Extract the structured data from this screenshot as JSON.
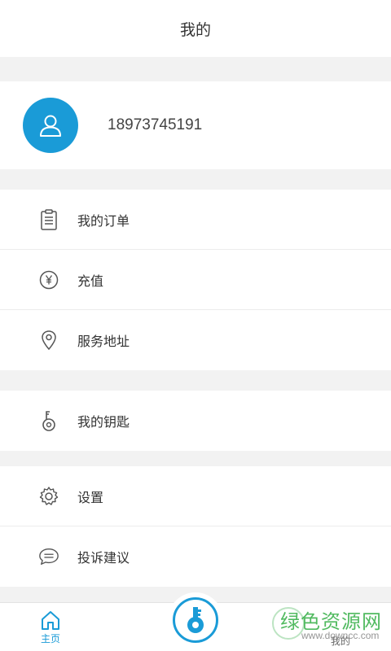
{
  "header": {
    "title": "我的"
  },
  "profile": {
    "phone": "18973745191",
    "avatar_icon": "user-icon"
  },
  "menu": {
    "group1": [
      {
        "label": "我的订单",
        "icon": "clipboard-icon"
      },
      {
        "label": "充值",
        "icon": "yen-icon"
      },
      {
        "label": "服务地址",
        "icon": "location-pin-icon"
      }
    ],
    "group2": [
      {
        "label": "我的钥匙",
        "icon": "key-icon"
      }
    ],
    "group3": [
      {
        "label": "设置",
        "icon": "gear-icon"
      },
      {
        "label": "投诉建议",
        "icon": "chat-bubble-icon"
      }
    ]
  },
  "tabbar": {
    "home_label": "主页",
    "mine_label": "我的"
  },
  "watermark": {
    "big": "绿色资源网",
    "small": "www.downcc.com"
  },
  "colors": {
    "accent": "#1a9bd7",
    "watermark": "#3fb34f"
  }
}
